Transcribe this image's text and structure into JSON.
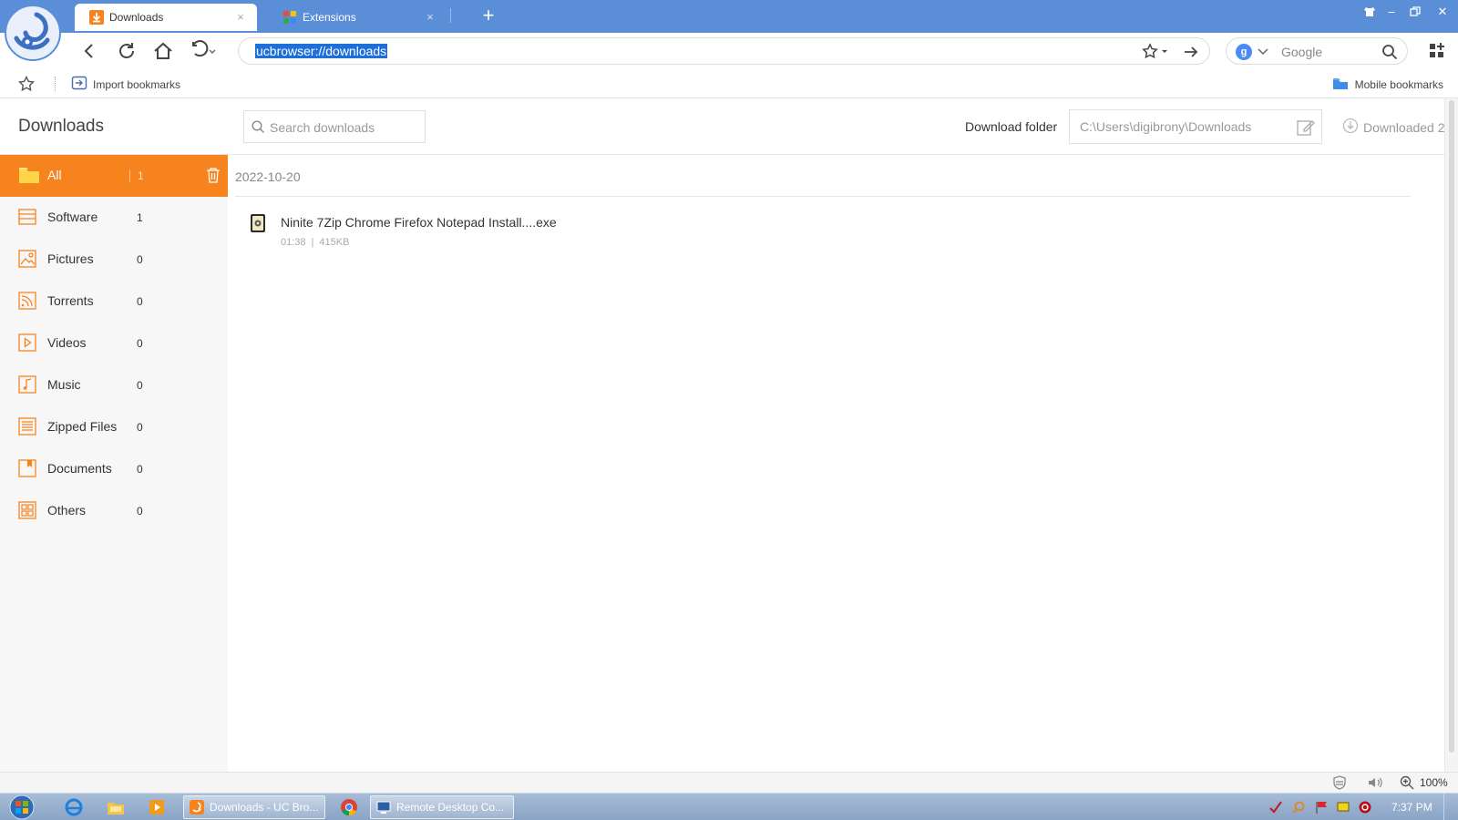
{
  "colors": {
    "titlebar": "#5a8fd8",
    "accent": "#f7831e",
    "selection": "#1e6fd9"
  },
  "tabs": [
    {
      "label": "Downloads",
      "icon": "download-icon",
      "active": true
    },
    {
      "label": "Extensions",
      "icon": "extensions-icon",
      "active": false
    }
  ],
  "address": {
    "url": "ucbrowser://downloads"
  },
  "search": {
    "engine": "Google"
  },
  "bookmarks": {
    "import_label": "Import bookmarks",
    "mobile_label": "Mobile bookmarks"
  },
  "page": {
    "title": "Downloads",
    "search_placeholder": "Search downloads",
    "folder_label": "Download folder",
    "folder_path": "C:\\Users\\digibrony\\Downloads",
    "downloaded_label": "Downloaded 2"
  },
  "categories": [
    {
      "label": "All",
      "count": "1",
      "icon": "folder-icon"
    },
    {
      "label": "Software",
      "count": "1",
      "icon": "software-icon"
    },
    {
      "label": "Pictures",
      "count": "0",
      "icon": "picture-icon"
    },
    {
      "label": "Torrents",
      "count": "0",
      "icon": "torrent-icon"
    },
    {
      "label": "Videos",
      "count": "0",
      "icon": "video-icon"
    },
    {
      "label": "Music",
      "count": "0",
      "icon": "music-icon"
    },
    {
      "label": "Zipped Files",
      "count": "0",
      "icon": "zip-icon"
    },
    {
      "label": "Documents",
      "count": "0",
      "icon": "document-icon"
    },
    {
      "label": "Others",
      "count": "0",
      "icon": "others-icon"
    }
  ],
  "downloads": {
    "date": "2022-10-20",
    "items": [
      {
        "name": "Ninite 7Zip Chrome Firefox Notepad Install....exe",
        "time": "01:38",
        "size": "415KB"
      }
    ]
  },
  "statusbar": {
    "zoom": "100%"
  },
  "taskbar": {
    "tasks": [
      {
        "label": "Downloads - UC Bro..."
      },
      {
        "label": "Remote Desktop Co..."
      }
    ],
    "clock": "7:37 PM"
  }
}
